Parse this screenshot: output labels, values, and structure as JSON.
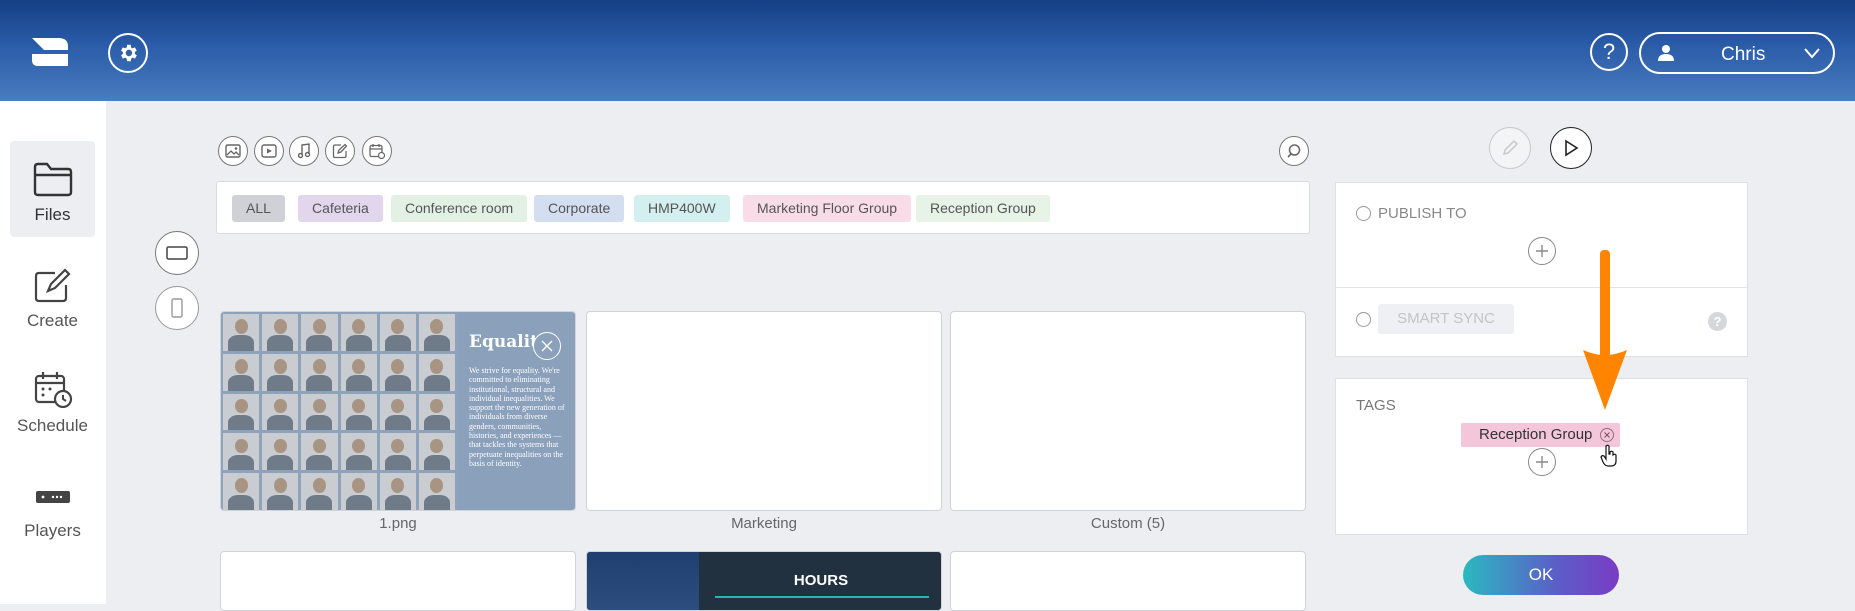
{
  "header": {
    "help_label": "?",
    "user_name": "Chris"
  },
  "sidebar": {
    "items": [
      {
        "label": "Files",
        "icon": "folder-icon",
        "active": true
      },
      {
        "label": "Create",
        "icon": "create-icon",
        "active": false
      },
      {
        "label": "Schedule",
        "icon": "schedule-icon",
        "active": false
      },
      {
        "label": "Players",
        "icon": "player-icon",
        "active": false
      }
    ]
  },
  "toolbar": {
    "tools": [
      "image-icon",
      "video-icon",
      "music-icon",
      "edit-icon",
      "calendar-icon"
    ],
    "search_icon": "search-icon"
  },
  "filters": [
    {
      "label": "ALL",
      "color": "#cfd1d6"
    },
    {
      "label": "Cafeteria",
      "color": "#e2d6ec"
    },
    {
      "label": "Conference room",
      "color": "#e2f1e4"
    },
    {
      "label": "Corporate",
      "color": "#d3def0"
    },
    {
      "label": "HMP400W",
      "color": "#d4eff0"
    },
    {
      "label": "Marketing Floor Group",
      "color": "#f8dde8"
    },
    {
      "label": "Reception Group",
      "color": "#e6f3e6"
    }
  ],
  "tiles": [
    {
      "label": "1.png",
      "title": "Equality",
      "body": "We strive for equality. We're committed to eliminating institutional, structural and individual inequalities. We support the new generation of individuals from diverse genders, communities, histories, and experiences — that tackles the systems that perpetuate inequalities on the basis of identity."
    },
    {
      "label": "Marketing"
    },
    {
      "label": "Custom (5)"
    },
    {
      "label": ""
    },
    {
      "label": "",
      "title": "HOURS"
    },
    {
      "label": ""
    }
  ],
  "publish": {
    "publish_to_label": "PUBLISH TO",
    "smart_sync_label": "SMART SYNC",
    "help_glyph": "?"
  },
  "tags": {
    "title": "TAGS",
    "items": [
      {
        "label": "Reception Group",
        "color": "#f3c6d9"
      }
    ]
  },
  "ok_label": "OK",
  "colors": {
    "accent_arrow": "#ff8400",
    "header_blue": "#1f4f99"
  }
}
